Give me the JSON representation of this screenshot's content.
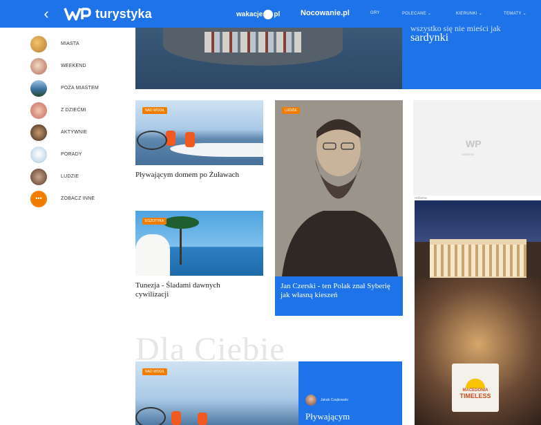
{
  "header": {
    "back_icon": "chevron-left-icon",
    "logo_text": "turystyka",
    "brand1_left": "wakacje",
    "brand1_right": "pl",
    "brand2": "Nocowanie.pl",
    "nav": [
      "GRY",
      "POLECANE",
      "KIERUNKI",
      "TEMATY"
    ]
  },
  "sidebar": {
    "items": [
      {
        "label": "MIASTA",
        "icon": "city-thumbnail"
      },
      {
        "label": "WEEKEND",
        "icon": "weekend-thumbnail"
      },
      {
        "label": "POZA MIASTEM",
        "icon": "nature-thumbnail"
      },
      {
        "label": "Z DZIEĆMI",
        "icon": "kids-thumbnail"
      },
      {
        "label": "AKTYWNIE",
        "icon": "active-thumbnail"
      },
      {
        "label": "PORADY",
        "icon": "tips-thumbnail"
      },
      {
        "label": "LUDZIE",
        "icon": "people-thumbnail"
      },
      {
        "label": "ZOBACZ INNE",
        "icon": "more-icon"
      }
    ]
  },
  "hero": {
    "title_cut": "wszystko się nie mieści jak",
    "title": "sardynki"
  },
  "cards": [
    {
      "badge": "NAD WODĄ",
      "title": "Pływającym domem po Żuławach"
    },
    {
      "badge": "LUDZIE",
      "title": "Jan Czerski - ten Polak znał Syberię jak własną kieszeń"
    },
    {
      "badge": "EGZOTYKA",
      "title": "Tunezja - Śladami dawnych cywilizacji"
    }
  ],
  "sponsor": {
    "logo": "WP",
    "label": "reklama"
  },
  "ad": {
    "label": "reklama",
    "badge_top": "MACEDONIA",
    "badge_bottom": "TIMELESS"
  },
  "section_title": "Dla Ciebie",
  "bottom_card": {
    "badge": "NAD WODĄ",
    "author": "Jakub Czajkowski",
    "title": "Pływającym"
  },
  "colors": {
    "brand_blue": "#1e73e8",
    "badge_orange": "#f07d00"
  }
}
